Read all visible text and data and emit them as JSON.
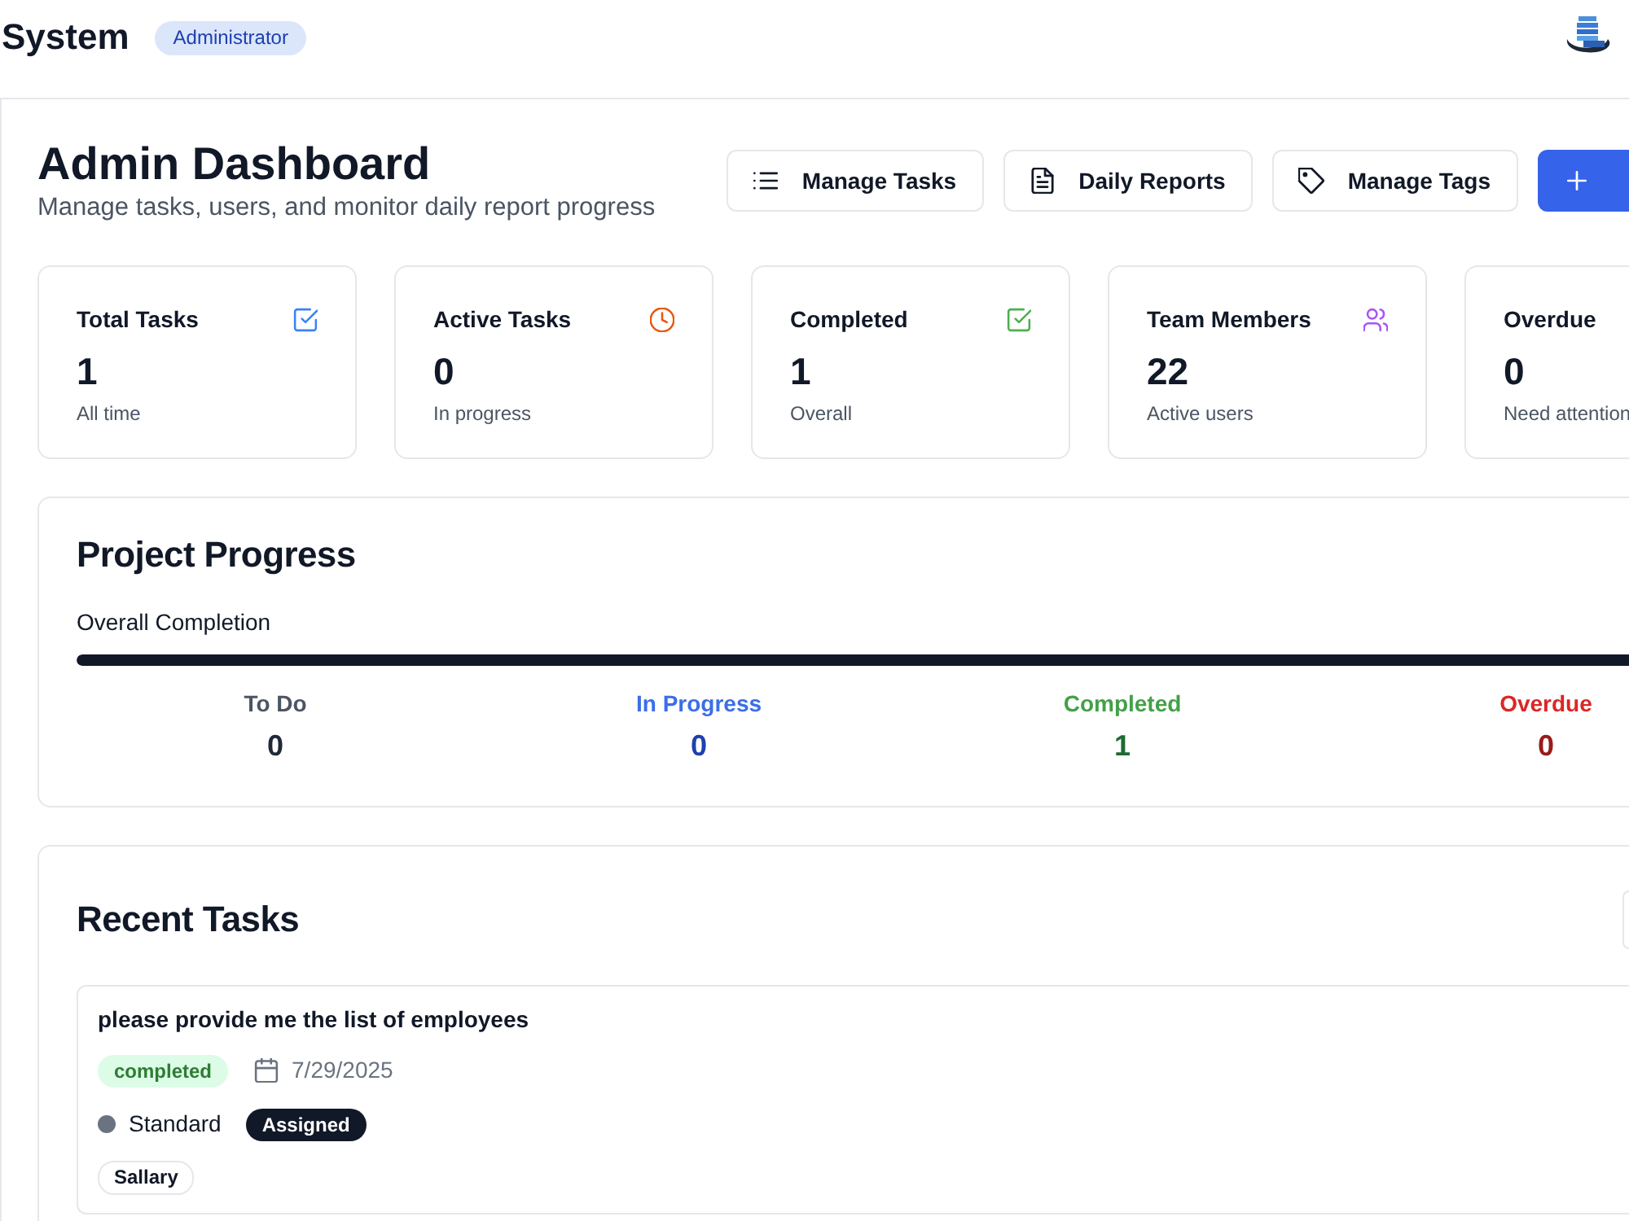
{
  "header": {
    "title": "System",
    "role_badge": "Administrator"
  },
  "page": {
    "title": "Admin Dashboard",
    "subtitle": "Manage tasks, users, and monitor daily report progress"
  },
  "actions": [
    {
      "kind": "list",
      "label": "Manage Tasks"
    },
    {
      "kind": "report",
      "label": "Daily Reports"
    },
    {
      "kind": "tag",
      "label": "Manage Tags"
    },
    {
      "kind": "create"
    }
  ],
  "stats": [
    {
      "kind": "total",
      "title": "Total Tasks",
      "value": "1",
      "caption": "All time"
    },
    {
      "kind": "active",
      "title": "Active Tasks",
      "value": "0",
      "caption": "In progress"
    },
    {
      "kind": "completed",
      "title": "Completed",
      "value": "1",
      "caption": "Overall"
    },
    {
      "kind": "members",
      "title": "Team Members",
      "value": "22",
      "caption": "Active users"
    },
    {
      "kind": "overdue",
      "title": "Overdue",
      "value": "0",
      "caption": "Need attention"
    }
  ],
  "progress": {
    "title": "Project Progress",
    "label": "Overall Completion",
    "level": 1,
    "counts": [
      {
        "kind": "todo",
        "label": "To Do",
        "value": "0"
      },
      {
        "kind": "in_progress",
        "label": "In Progress",
        "value": "0"
      },
      {
        "kind": "completed",
        "label": "Completed",
        "value": "1"
      },
      {
        "kind": "overdue",
        "label": "Overdue",
        "value": "0"
      }
    ]
  },
  "recent_tasks": {
    "title": "Recent Tasks",
    "tasks": [
      {
        "title": "please provide me the list of employees",
        "status": {
          "kind": "completed",
          "label": "completed"
        },
        "date": "7/29/2025",
        "priority": {
          "label": "Standard",
          "color": "#6b7280"
        },
        "assignment": "Assigned",
        "tags": [
          "Sallary"
        ]
      }
    ]
  }
}
